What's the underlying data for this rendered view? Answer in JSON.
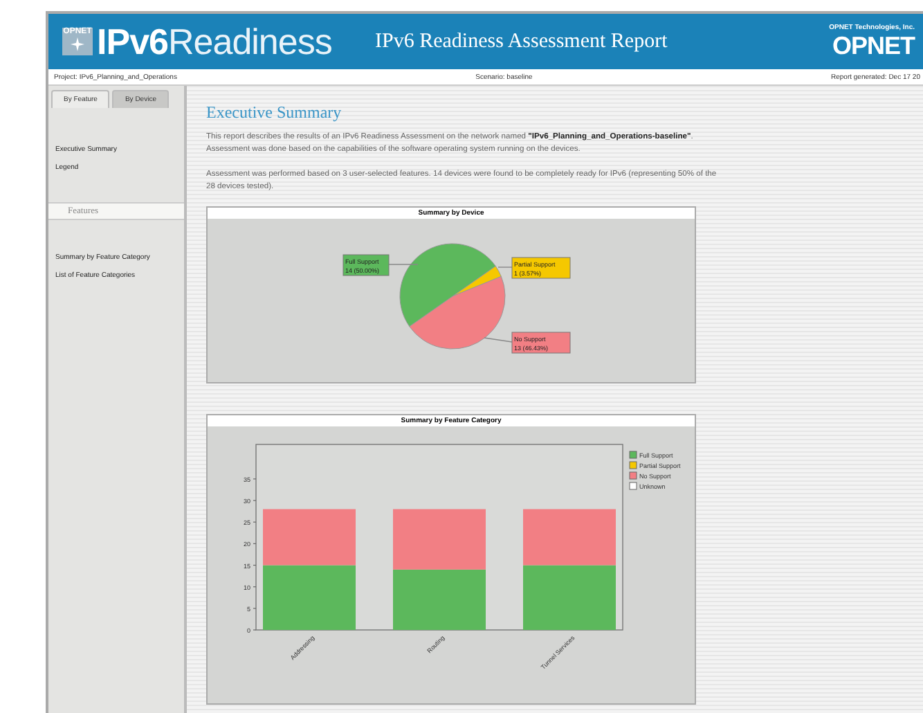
{
  "header": {
    "logo_badge": "OPNET",
    "logo": "**IPv6**Readiness",
    "title": "IPv6 Readiness Assessment Report",
    "company": "OPNET Technologies, Inc.",
    "brand": "OPNET"
  },
  "info_bar": {
    "project": "Project: IPv6_Planning_and_Operations",
    "scenario": "Scenario: baseline",
    "generated": "Report generated: Dec 17 20"
  },
  "tabs": [
    {
      "label": "By Feature",
      "selected": true
    },
    {
      "label": "By Device",
      "selected": false
    }
  ],
  "sidebar": {
    "items": [
      "Executive Summary",
      "Legend"
    ],
    "section": "Features",
    "section_items": [
      "Summary by Feature Category",
      "List of Feature Categories"
    ]
  },
  "main": {
    "heading": "Executive Summary",
    "paragraphs": [
      "This report describes the results of an IPv6 Readiness Assessment on the network named **\"IPv6_Planning_and_Operations-baseline\"**. Assessment was done based on the capabilities of the software operating system running on the devices.",
      "Assessment was performed based on 3 user-selected features. 14 devices were found to be completely ready for IPv6 (representing 50% of the 28 devices tested)."
    ],
    "pie": {
      "chart_data": {
        "type": "pie",
        "title": "Summary by Device",
        "categories": [
          "Full Support",
          "Partial Support",
          "No Support"
        ],
        "values": [
          14,
          1,
          13
        ],
        "colors": [
          "#5cb85c",
          "#f5c800",
          "#f27f84"
        ],
        "value_labels": [
          "14 (50.00%)",
          "1 (3.57%)",
          "13 (46.43%)"
        ]
      }
    },
    "bar": {
      "chart_data": {
        "type": "bar",
        "title": "Summary by Feature Category",
        "stacked": true,
        "categories": [
          "Addressing",
          "Routing",
          "Tunnel Services"
        ],
        "series": [
          {
            "name": "Full Support",
            "color": "#5cb85c",
            "values": [
              15,
              14,
              15
            ]
          },
          {
            "name": "Partial Support",
            "color": "#f5c800",
            "values": [
              0,
              0,
              0
            ]
          },
          {
            "name": "No Support",
            "color": "#f27f84",
            "values": [
              13,
              14,
              13
            ]
          },
          {
            "name": "Unknown",
            "color": "#ffffff",
            "values": [
              0,
              0,
              0
            ]
          }
        ],
        "legend": "right",
        "ylim": [
          0,
          43
        ],
        "yticks": [
          0,
          5,
          10,
          15,
          20,
          25,
          30,
          35
        ]
      }
    }
  }
}
